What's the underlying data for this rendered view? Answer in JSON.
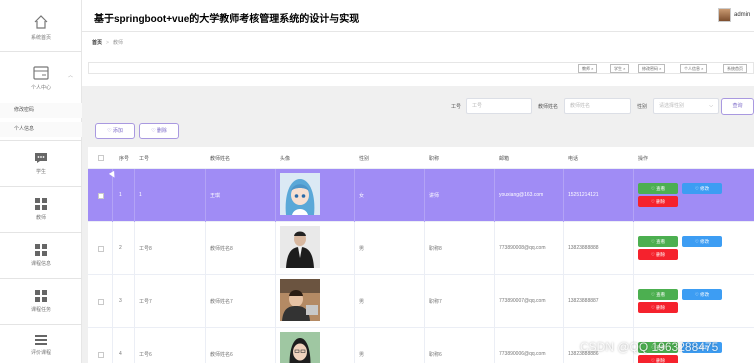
{
  "app": {
    "title": "基于springboot+vue的大学教师考核管理系统的设计与实现",
    "user": "admin"
  },
  "sidebar": {
    "items": [
      {
        "label": "系统首页",
        "icon": "home-icon"
      },
      {
        "label": "个人中心",
        "icon": "id-card-icon"
      },
      {
        "label": "学生",
        "icon": "chat-icon"
      },
      {
        "label": "教师",
        "icon": "grid-icon"
      },
      {
        "label": "课程信息",
        "icon": "grid-icon"
      },
      {
        "label": "课程任务",
        "icon": "grid-icon"
      },
      {
        "label": "评价课程",
        "icon": "list-icon"
      }
    ],
    "sub_items": [
      {
        "label": "修改密码"
      },
      {
        "label": "个人信息"
      }
    ]
  },
  "breadcrumb": {
    "home": "首页",
    "current": "教师"
  },
  "tags": [
    {
      "label": "教师 ×"
    },
    {
      "label": "学生 ×"
    },
    {
      "label": "修改密码 ×"
    },
    {
      "label": "个人信息 ×"
    },
    {
      "label": "系统首页"
    }
  ],
  "search": {
    "gonghao_label": "工号",
    "gonghao_placeholder": "工号",
    "name_label": "教师姓名",
    "name_placeholder": "教师姓名",
    "gender_label": "性别",
    "gender_placeholder": "请选择性别",
    "query_button": "查询"
  },
  "toolbar": {
    "add_label": "♡ 添加",
    "delete_label": "♡ 删除"
  },
  "table": {
    "columns": [
      "序号",
      "工号",
      "教师姓名",
      "头像",
      "性别",
      "职称",
      "邮箱",
      "电话",
      "操作"
    ],
    "actions": {
      "view": "♡ 查看",
      "edit": "♡ 修改",
      "delete": "♡ 删除"
    },
    "rows": [
      {
        "index": "1",
        "gonghao": "1",
        "name": "王琪",
        "gender": "女",
        "title": "讲师",
        "email": "youxiang@163.com",
        "phone": "15251214121",
        "selected": true
      },
      {
        "index": "2",
        "gonghao": "工号8",
        "name": "教师姓名8",
        "gender": "男",
        "title": "职称8",
        "email": "773890008@qq.com",
        "phone": "13823888888",
        "selected": false
      },
      {
        "index": "3",
        "gonghao": "工号7",
        "name": "教师姓名7",
        "gender": "男",
        "title": "职称7",
        "email": "773890007@qq.com",
        "phone": "13823888887",
        "selected": false
      },
      {
        "index": "4",
        "gonghao": "工号6",
        "name": "教师姓名6",
        "gender": "男",
        "title": "职称6",
        "email": "773890006@qq.com",
        "phone": "13823888886",
        "selected": false
      }
    ]
  },
  "watermark": "CSDN @QQ 1963288475",
  "colors": {
    "selected_row": "#a08cf5",
    "view": "#4caf50",
    "edit": "#3d9df3",
    "delete": "#f5222d",
    "accent": "#7b68c8"
  }
}
